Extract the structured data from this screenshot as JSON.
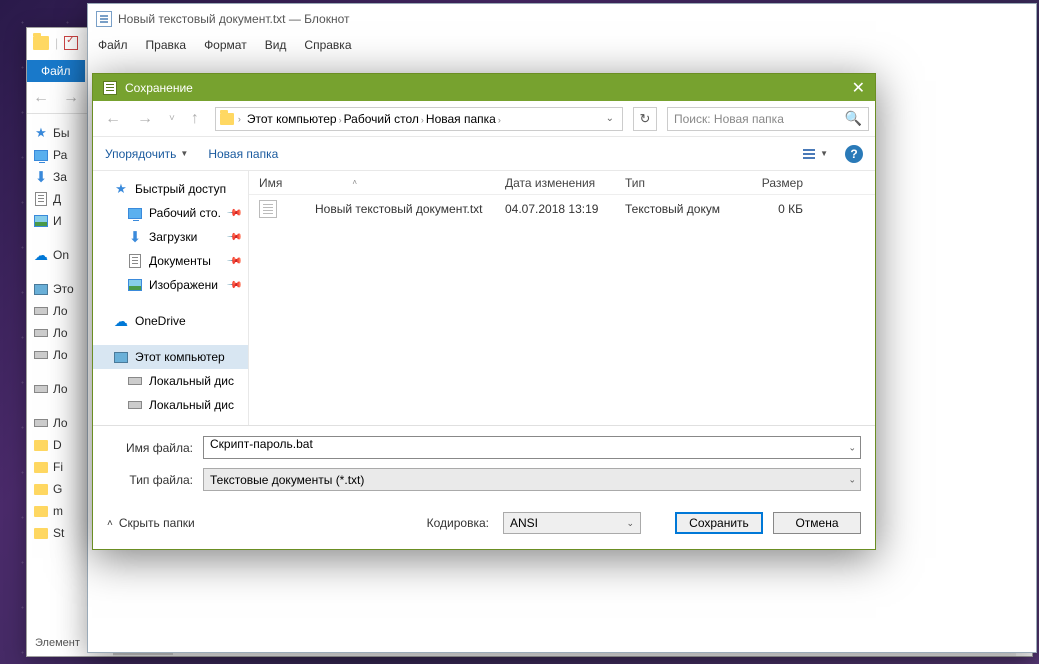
{
  "bg_explorer": {
    "ribbon_tab": "Файл",
    "tree_items": [
      {
        "label": "Бы",
        "icon": "star"
      },
      {
        "label": "Ра",
        "icon": "desktop"
      },
      {
        "label": "За",
        "icon": "dl"
      },
      {
        "label": "Д",
        "icon": "doc"
      },
      {
        "label": "И",
        "icon": "img"
      },
      {
        "label": "On",
        "icon": "cloud",
        "gap": true
      },
      {
        "label": "Это",
        "icon": "pc",
        "gap": true
      },
      {
        "label": "Ло",
        "icon": "drive"
      },
      {
        "label": "Ло",
        "icon": "drive"
      },
      {
        "label": "Ло",
        "icon": "drive"
      },
      {
        "label": "Ло",
        "icon": "drive",
        "gap": true
      },
      {
        "label": "Ло",
        "icon": "drive",
        "gap": true
      },
      {
        "label": "D",
        "icon": "folder"
      },
      {
        "label": "Fi",
        "icon": "folder"
      },
      {
        "label": "G",
        "icon": "folder"
      },
      {
        "label": "m",
        "icon": "folder"
      },
      {
        "label": "St",
        "icon": "folder"
      }
    ],
    "status": "Элемент"
  },
  "notepad": {
    "title": "Новый текстовый документ.txt — Блокнот",
    "menu": [
      "Файл",
      "Правка",
      "Формат",
      "Вид",
      "Справка"
    ]
  },
  "dialog": {
    "title": "Сохранение",
    "breadcrumbs": [
      "Этот компьютер",
      "Рабочий стол",
      "Новая папка"
    ],
    "search_placeholder": "Поиск: Новая папка",
    "toolbar": {
      "organize": "Упорядочить",
      "new_folder": "Новая папка"
    },
    "columns": {
      "name": "Имя",
      "date": "Дата изменения",
      "type": "Тип",
      "size": "Размер"
    },
    "tree": [
      {
        "label": "Быстрый доступ",
        "icon": "star",
        "level": 0
      },
      {
        "label": "Рабочий сто.",
        "icon": "desktop",
        "level": 1,
        "pin": true
      },
      {
        "label": "Загрузки",
        "icon": "dl",
        "level": 1,
        "pin": true
      },
      {
        "label": "Документы",
        "icon": "doc",
        "level": 1,
        "pin": true
      },
      {
        "label": "Изображени",
        "icon": "img",
        "level": 1,
        "pin": true
      },
      {
        "label": "OneDrive",
        "icon": "cloud",
        "level": 0,
        "gap": true
      },
      {
        "label": "Этот компьютер",
        "icon": "pc",
        "level": 0,
        "sel": true,
        "gap": true
      },
      {
        "label": "Локальный дис",
        "icon": "drive",
        "level": 1
      },
      {
        "label": "Локальный дис",
        "icon": "drive",
        "level": 1
      }
    ],
    "files": [
      {
        "name": "Новый текстовый документ.txt",
        "date": "04.07.2018 13:19",
        "type": "Текстовый докум",
        "size": "0 КБ"
      }
    ],
    "labels": {
      "filename": "Имя файла:",
      "filetype": "Тип файла:",
      "encoding": "Кодировка:",
      "hide": "Скрыть папки"
    },
    "filename_value": "Скрипт-пароль.bat",
    "filetype_value": "Текстовые документы (*.txt)",
    "encoding_value": "ANSI",
    "buttons": {
      "save": "Сохранить",
      "cancel": "Отмена"
    }
  }
}
